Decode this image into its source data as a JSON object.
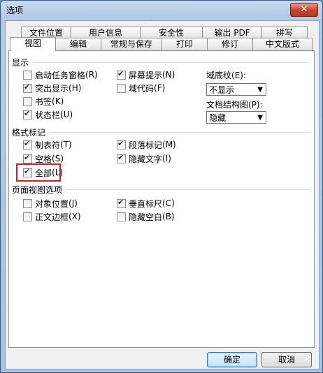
{
  "window": {
    "title": "选项",
    "close_glyph": "✕"
  },
  "tabs_back": [
    "文件位置",
    "用户信息",
    "安全性",
    "输出 PDF",
    "拼写"
  ],
  "tabs_front": [
    "视图",
    "编辑",
    "常规与保存",
    "打印",
    "修订",
    "中文版式"
  ],
  "active_tab": "视图",
  "display": {
    "title": "显示",
    "startup_taskpane": {
      "label": "启动任务窗格",
      "key": "(R)",
      "checked": false
    },
    "highlight": {
      "label": "突出显示",
      "key": "(H)",
      "checked": true
    },
    "bookmark": {
      "label": "书签",
      "key": "(K)",
      "checked": false
    },
    "statusbar": {
      "label": "状态栏",
      "key": "(U)",
      "checked": true
    },
    "screentip": {
      "label": "屏幕提示",
      "key": "(N)",
      "checked": true
    },
    "fieldcode": {
      "label": "域代码",
      "key": "(F)",
      "checked": false
    },
    "field_shading_label": "域底纹",
    "field_shading_key": "(E):",
    "field_shading_value": "不显示",
    "docmap_label": "文档结构图",
    "docmap_key": "(P):",
    "docmap_value": "隐藏"
  },
  "format": {
    "title": "格式标记",
    "tab": {
      "label": "制表符",
      "key": "(T)",
      "checked": true
    },
    "space": {
      "label": "空格",
      "key": "(S)",
      "checked": true
    },
    "all": {
      "label": "全部",
      "key": "(L)",
      "checked": true
    },
    "para": {
      "label": "段落标记",
      "key": "(M)",
      "checked": true
    },
    "hidden": {
      "label": "隐藏文字",
      "key": "(I)",
      "checked": true
    }
  },
  "page": {
    "title": "页面视图选项",
    "objpos": {
      "label": "对象位置",
      "key": "(J)",
      "checked": false
    },
    "textbound": {
      "label": "正文边框",
      "key": "(X)",
      "checked": false
    },
    "vruler": {
      "label": "垂直标尺",
      "key": "(C)",
      "checked": true
    },
    "hidewhite": {
      "label": "隐藏空白",
      "key": "(B)",
      "checked": false
    }
  },
  "buttons": {
    "ok": "确定",
    "cancel": "取消"
  }
}
